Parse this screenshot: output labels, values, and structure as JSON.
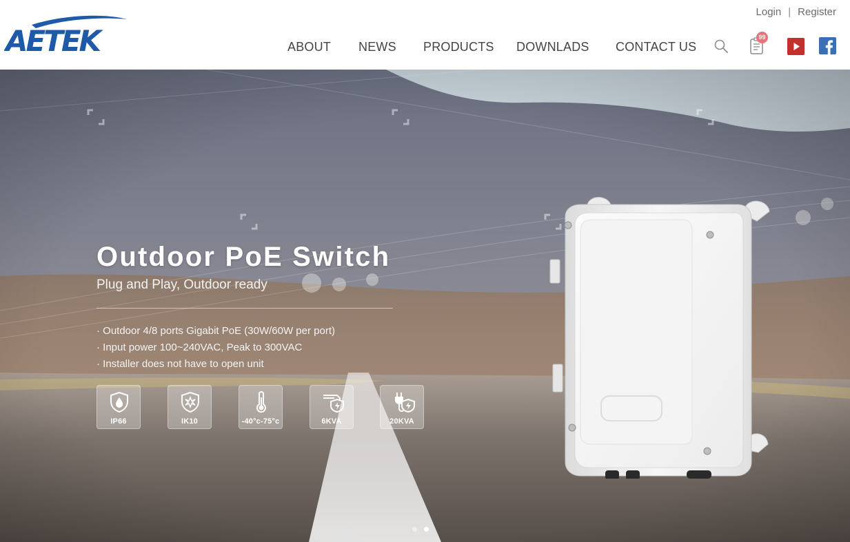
{
  "brand": {
    "logo_text": "AETEK",
    "colors": {
      "logo": "#1f5aa8",
      "nav_text": "#444444",
      "youtube": "#c4302b",
      "facebook": "#3b6fb5",
      "badge": "#e9737a"
    }
  },
  "top_links": {
    "login": "Login",
    "separator": "|",
    "register": "Register"
  },
  "nav": {
    "items": [
      "ABOUT",
      "NEWS",
      "PRODUCTS",
      "DOWNLADS",
      "CONTACT US"
    ],
    "icons": {
      "search": "search-icon",
      "cart": "document-icon",
      "youtube": "youtube-icon",
      "facebook": "facebook-icon"
    },
    "cart_badge": "99"
  },
  "hero": {
    "title": "Outdoor PoE Switch",
    "subtitle": "Plug and Play, Outdoor ready",
    "features": [
      "· Outdoor 4/8 ports Gigabit PoE (30W/60W per port)",
      "· Input power 100~240VAC, Peak to 300VAC",
      "· Installer does not have to open unit"
    ],
    "specs": [
      {
        "label": "IP66",
        "icon": "water-drop-shield-icon"
      },
      {
        "label": "IK10",
        "icon": "impact-shield-icon"
      },
      {
        "label": "-40°c-75°c",
        "icon": "thermometer-icon"
      },
      {
        "label": "6KVA",
        "icon": "surge-network-icon"
      },
      {
        "label": "20KVA",
        "icon": "surge-power-plug-icon"
      }
    ],
    "slides": {
      "count": 2,
      "active_index": 1
    }
  }
}
